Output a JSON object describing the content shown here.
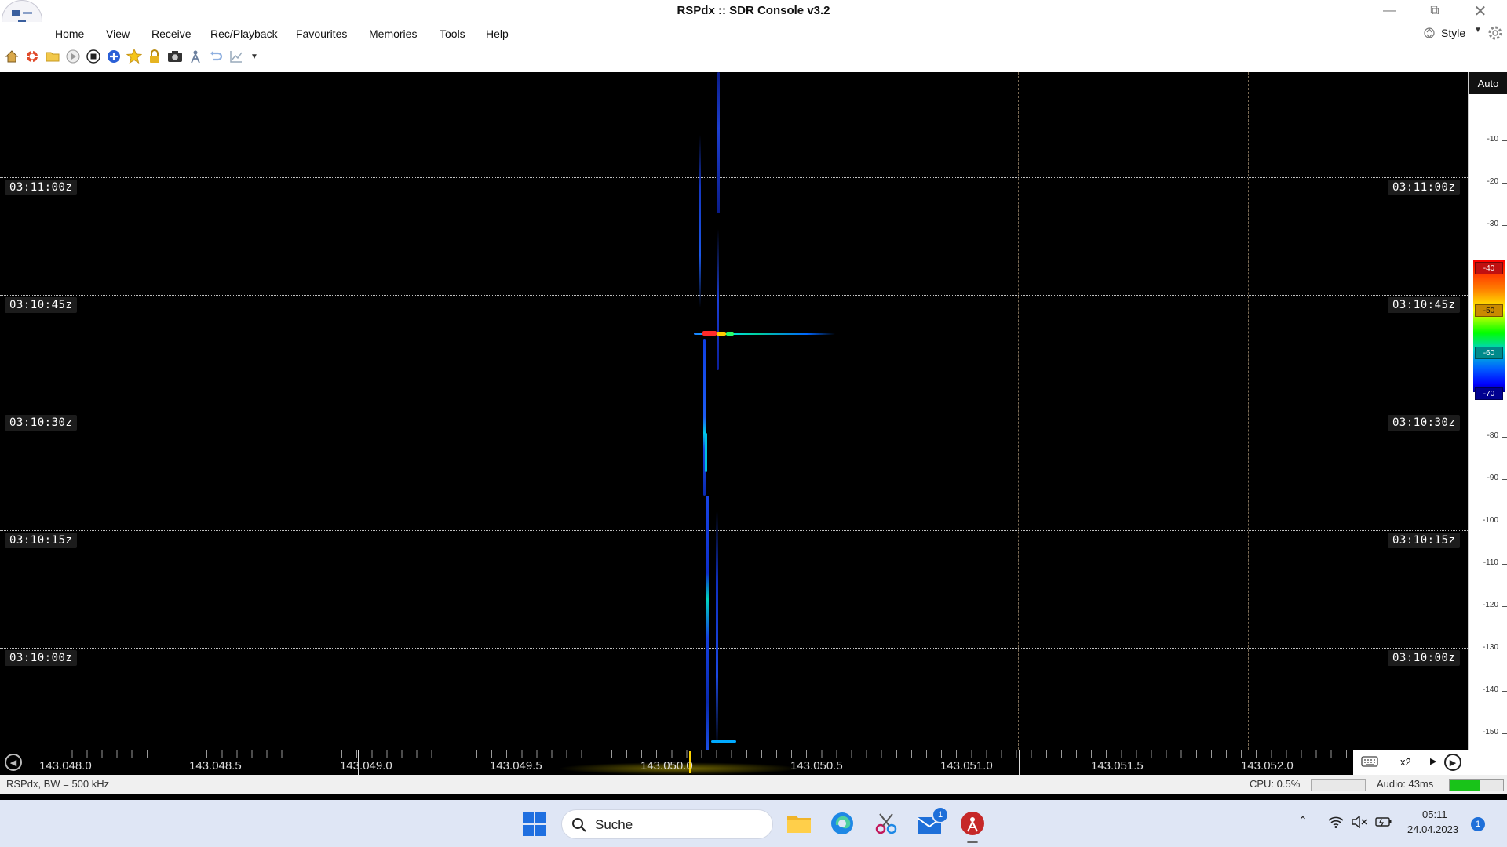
{
  "window": {
    "title": "RSPdx :: SDR Console v3.2",
    "minimize_icon": "minimize-icon",
    "restore_icon": "restore-icon",
    "close_icon": "close-icon"
  },
  "menu": {
    "items": [
      "Home",
      "View",
      "Receive",
      "Rec/Playback",
      "Favourites",
      "Memories",
      "Tools",
      "Help"
    ],
    "style_label": "Style"
  },
  "toolbar": {
    "icons": [
      "home-icon",
      "lifebuoy-icon",
      "folder-icon",
      "play-icon",
      "stop-icon",
      "add-icon",
      "favourite-star-icon",
      "lock-icon",
      "camera-icon",
      "antenna-icon",
      "undo-icon",
      "chart-icon",
      "more-dropdown-icon"
    ]
  },
  "waterfall": {
    "timestamps": [
      "03:11:00z",
      "03:10:45z",
      "03:10:30z",
      "03:10:15z",
      "03:10:00z"
    ]
  },
  "db_scale": {
    "auto_label": "Auto",
    "ticks": [
      "-10",
      "-20",
      "-30",
      "-40",
      "-50",
      "-60",
      "-70",
      "-80",
      "-90",
      "-100",
      "-110",
      "-120",
      "-130",
      "-140",
      "-150"
    ],
    "color_markers": [
      "-40",
      "-50",
      "-60",
      "-70"
    ]
  },
  "frequency_axis": {
    "labels": [
      "143.048.0",
      "143.048.5",
      "143.049.0",
      "143.049.5",
      "143.050.0",
      "143.050.5",
      "143.051.0",
      "143.051.5",
      "143.052.0"
    ],
    "zoom_label": "x2"
  },
  "status": {
    "left": "RSPdx, BW = 500 kHz",
    "cpu": "CPU: 0.5%",
    "audio": "Audio: 43ms"
  },
  "taskbar": {
    "search_placeholder": "Suche",
    "mail_badge": "1",
    "time": "05:11",
    "date": "24.04.2023",
    "notification_count": "1"
  },
  "colors": {
    "accent_signal": "#00e5ff",
    "center_frequency_marker": "#ffd400",
    "audio_level": "#19c319"
  }
}
